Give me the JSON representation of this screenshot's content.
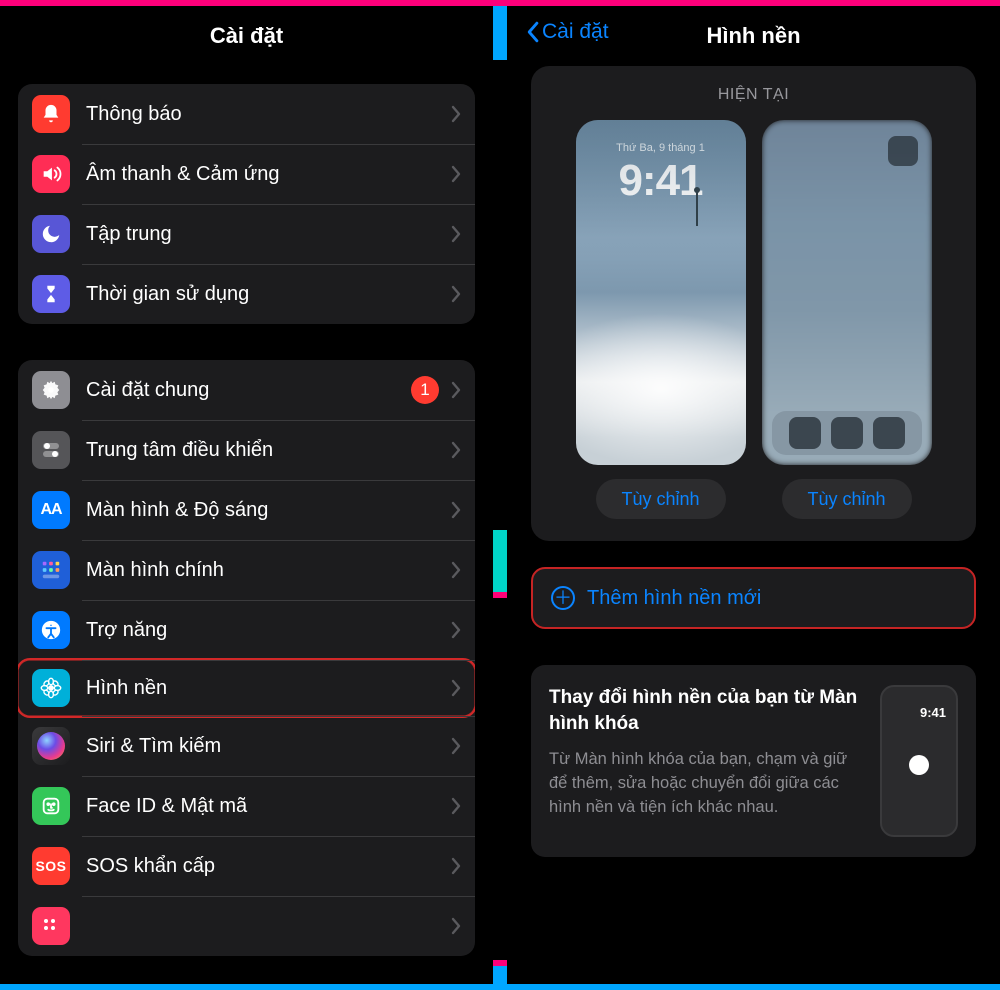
{
  "left": {
    "title": "Cài đặt",
    "group1": [
      {
        "label": "Thông báo",
        "icon": "bell",
        "color": "ic-red"
      },
      {
        "label": "Âm thanh & Cảm ứng",
        "icon": "sound",
        "color": "ic-pink"
      },
      {
        "label": "Tập trung",
        "icon": "moon",
        "color": "ic-purple"
      },
      {
        "label": "Thời gian sử dụng",
        "icon": "hourglass",
        "color": "ic-indigo"
      }
    ],
    "group2": [
      {
        "label": "Cài đặt chung",
        "icon": "gear",
        "color": "ic-gray",
        "badge": "1"
      },
      {
        "label": "Trung tâm điều khiển",
        "icon": "sliders",
        "color": "ic-gray2"
      },
      {
        "label": "Màn hình & Độ sáng",
        "icon": "aa",
        "color": "ic-blue"
      },
      {
        "label": "Màn hình chính",
        "icon": "grid",
        "color": "ic-darkblue"
      },
      {
        "label": "Trợ năng",
        "icon": "access",
        "color": "ic-blue"
      },
      {
        "label": "Hình nền",
        "icon": "flower",
        "color": "ic-cyan",
        "highlight": true
      },
      {
        "label": "Siri & Tìm kiếm",
        "icon": "siri",
        "color": "ic-siri"
      },
      {
        "label": "Face ID & Mật mã",
        "icon": "face",
        "color": "ic-green"
      },
      {
        "label": "SOS khẩn cấp",
        "icon": "sos",
        "color": "ic-sos"
      },
      {
        "label": "",
        "icon": "dots",
        "color": "ic-pink2"
      }
    ]
  },
  "right": {
    "back": "Cài đặt",
    "title": "Hình nền",
    "current_label": "HIỆN TẠI",
    "lock_date": "Thứ Ba, 9 tháng 1",
    "lock_time": "9:41",
    "customize": "Tùy chỉnh",
    "add_new": "Thêm hình nền mới",
    "hint_title": "Thay đổi hình nền của bạn từ Màn hình khóa",
    "hint_body": "Từ Màn hình khóa của bạn, chạm và giữ để thêm, sửa hoặc chuyển đổi giữa các hình nền và tiện ích khác nhau.",
    "mini_time": "9:41"
  }
}
